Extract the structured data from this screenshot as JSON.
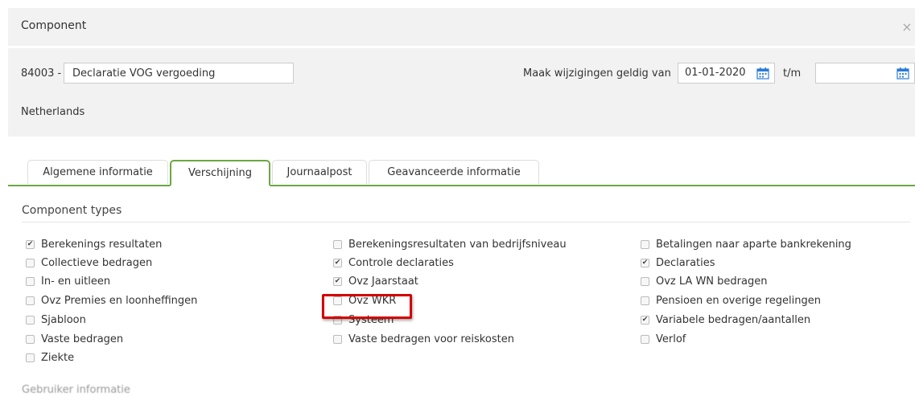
{
  "header": {
    "title": "Component",
    "close_glyph": "×"
  },
  "form": {
    "code": "84003 -",
    "name_value": "Declaratie VOG vergoeding",
    "valid_label": "Maak wijzigingen geldig van",
    "date_from": "01-01-2020",
    "to_label": "t/m",
    "date_to": "",
    "country": "Netherlands"
  },
  "tabs": [
    {
      "label": "Algemene informatie"
    },
    {
      "label": "Verschijning"
    },
    {
      "label": "Journaalpost"
    },
    {
      "label": "Geavanceerde informatie"
    }
  ],
  "active_tab": "Verschijning",
  "section": {
    "title": "Component types"
  },
  "checkboxes": [
    {
      "label": "Berekenings resultaten",
      "checked": true
    },
    {
      "label": "Berekeningsresultaten van bedrijfsniveau",
      "checked": false
    },
    {
      "label": "Betalingen naar aparte bankrekening",
      "checked": false
    },
    {
      "label": "Collectieve bedragen",
      "checked": false
    },
    {
      "label": "Controle declaraties",
      "checked": true
    },
    {
      "label": "Declaraties",
      "checked": true
    },
    {
      "label": "In- en uitleen",
      "checked": false
    },
    {
      "label": "Ovz Jaarstaat",
      "checked": true
    },
    {
      "label": "Ovz LA WN bedragen",
      "checked": false
    },
    {
      "label": "Ovz Premies en loonheffingen",
      "checked": false
    },
    {
      "label": "Ovz WKR",
      "checked": false
    },
    {
      "label": "Pensioen en overige regelingen",
      "checked": false
    },
    {
      "label": "Sjabloon",
      "checked": false
    },
    {
      "label": "Systeem",
      "checked": false
    },
    {
      "label": "Variabele bedragen/aantallen",
      "checked": true
    },
    {
      "label": "Vaste bedragen",
      "checked": false
    },
    {
      "label": "Vaste bedragen voor reiskosten",
      "checked": false
    },
    {
      "label": "Verlof",
      "checked": false
    },
    {
      "label": "Ziekte",
      "checked": false
    }
  ],
  "next_section_partial": "Gebruiker informatie",
  "colors": {
    "accent_green": "#6ba843",
    "highlight_red": "#d40000",
    "calendar_blue": "#2a7bd4"
  }
}
